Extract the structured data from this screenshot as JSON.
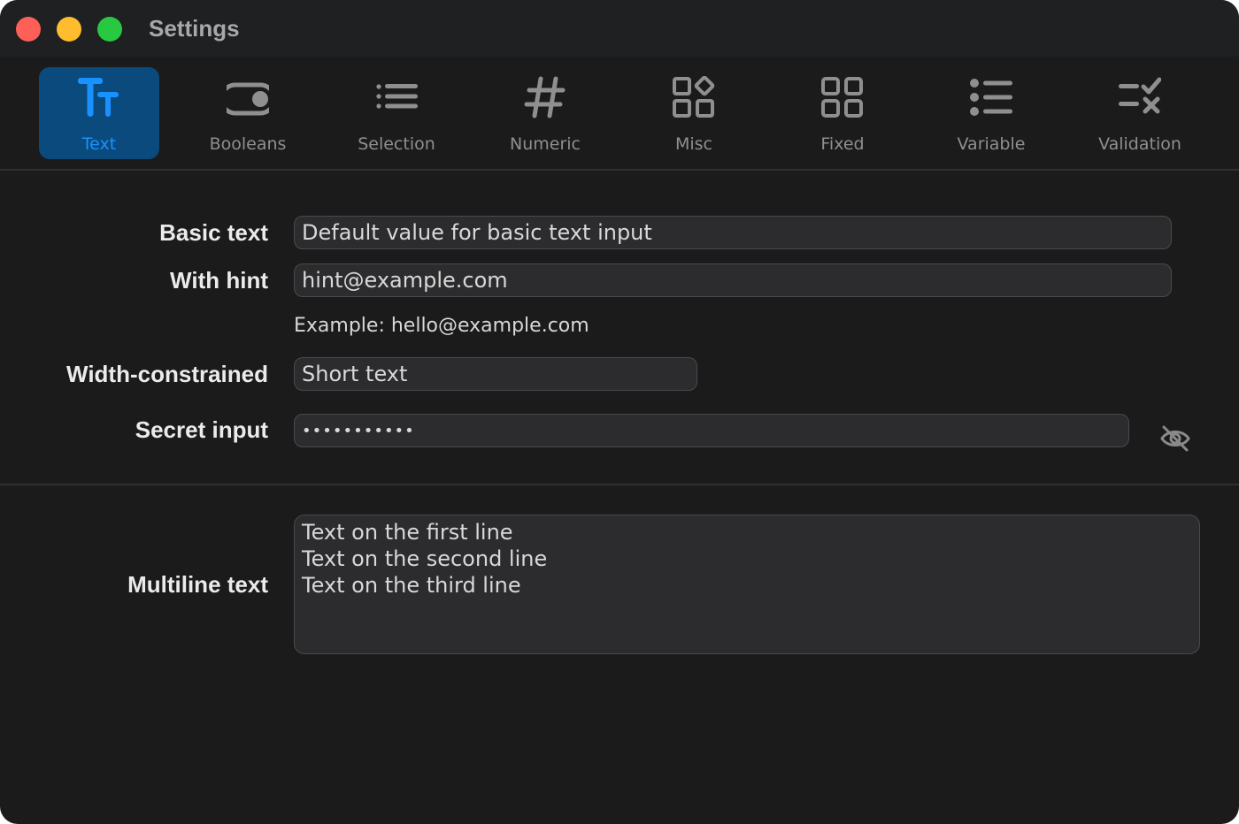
{
  "window": {
    "title": "Settings"
  },
  "toolbar": {
    "tabs": [
      {
        "label": "Text",
        "icon": "text-format-icon",
        "selected": true
      },
      {
        "label": "Booleans",
        "icon": "toggle-icon"
      },
      {
        "label": "Selection",
        "icon": "list-icon"
      },
      {
        "label": "Numeric",
        "icon": "hash-icon"
      },
      {
        "label": "Misc",
        "icon": "shapes-icon"
      },
      {
        "label": "Fixed",
        "icon": "grid-icon"
      },
      {
        "label": "Variable",
        "icon": "bullet-list-icon"
      },
      {
        "label": "Validation",
        "icon": "check-x-icon"
      }
    ]
  },
  "form": {
    "basic": {
      "label": "Basic text",
      "value": "Default value for basic text input"
    },
    "hint": {
      "label": "With hint",
      "value": "hint@example.com",
      "help": "Example: hello@example.com"
    },
    "width": {
      "label": "Width-constrained",
      "value": "Short text"
    },
    "secret": {
      "label": "Secret input",
      "value": "•••••••••••"
    },
    "multiline": {
      "label": "Multiline text",
      "lines": [
        "Text on the first line",
        "Text on the second line",
        "Text on the third line"
      ]
    }
  },
  "colors": {
    "accent": "#1992ff",
    "selected_tab": "#0a4a7d",
    "background": "#1b1b1b",
    "field": "#2c2c2e"
  }
}
